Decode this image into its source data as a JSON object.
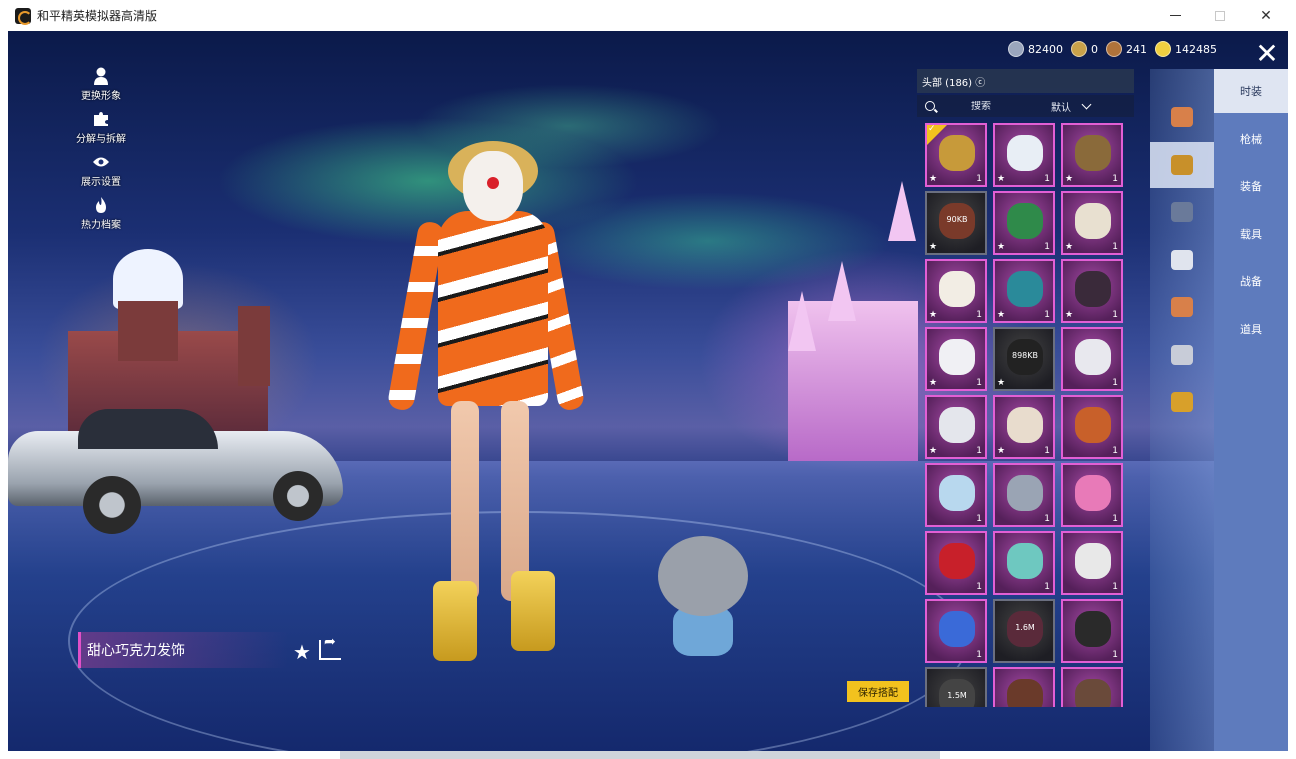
{
  "window": {
    "title": "和平精英模拟器高清版"
  },
  "currencies": [
    {
      "icon": "coin-icon",
      "value": "82400",
      "color": "#9aa6bd"
    },
    {
      "icon": "token-icon",
      "value": "0",
      "color": "#c9a24a"
    },
    {
      "icon": "medal-icon",
      "value": "241",
      "color": "#b0733a"
    },
    {
      "icon": "gold-coin-icon",
      "value": "142485",
      "color": "#f0d040"
    }
  ],
  "left_menu": [
    {
      "icon": "person-icon",
      "label": "更换形象"
    },
    {
      "icon": "puzzle-icon",
      "label": "分解与拆解"
    },
    {
      "icon": "eye-icon",
      "label": "展示设置"
    },
    {
      "icon": "flame-icon",
      "label": "热力档案"
    }
  ],
  "selected_item": {
    "name": "甜心巧克力发饰"
  },
  "save_button": "保存搭配",
  "panel": {
    "header": "头部 (186) ⓒ",
    "search_placeholder": "搜索",
    "sort_value": "默认"
  },
  "grid_items": [
    {
      "rarity": "purple",
      "art": "#c79a3a",
      "star": true,
      "qty": "1",
      "equipped": true
    },
    {
      "rarity": "purple",
      "art": "#e8eef5",
      "star": true,
      "qty": "1"
    },
    {
      "rarity": "purple",
      "art": "#8a6a3a",
      "star": true,
      "qty": "1"
    },
    {
      "rarity": "dark",
      "art": "#7a3a2a",
      "star": true,
      "qty": "",
      "download": "90KB"
    },
    {
      "rarity": "purple",
      "art": "#2f8a4a",
      "star": true,
      "qty": "1"
    },
    {
      "rarity": "purple",
      "art": "#e8e0d0",
      "star": true,
      "qty": "1"
    },
    {
      "rarity": "purple",
      "art": "#f2ede4",
      "star": true,
      "qty": "1"
    },
    {
      "rarity": "purple",
      "art": "#2a8a9a",
      "star": true,
      "qty": "1"
    },
    {
      "rarity": "purple",
      "art": "#3a2a3a",
      "star": true,
      "qty": "1"
    },
    {
      "rarity": "purple",
      "art": "#f0f0f4",
      "star": true,
      "qty": "1"
    },
    {
      "rarity": "dark",
      "art": "#222222",
      "star": true,
      "qty": "",
      "download": "898KB"
    },
    {
      "rarity": "purple",
      "art": "#e8e8ee",
      "star": false,
      "qty": "1"
    },
    {
      "rarity": "purple",
      "art": "#e4e6ec",
      "star": true,
      "qty": "1"
    },
    {
      "rarity": "purple",
      "art": "#e8dccd",
      "star": true,
      "qty": "1"
    },
    {
      "rarity": "purple",
      "art": "#c8602a",
      "star": false,
      "qty": "1"
    },
    {
      "rarity": "purple",
      "art": "#b8d8ee",
      "star": false,
      "qty": "1"
    },
    {
      "rarity": "purple",
      "art": "#9aa4b4",
      "star": false,
      "qty": "1"
    },
    {
      "rarity": "purple",
      "art": "#e87ab8",
      "star": false,
      "qty": "1"
    },
    {
      "rarity": "purple",
      "art": "#c8202a",
      "star": false,
      "qty": "1"
    },
    {
      "rarity": "purple",
      "art": "#6ec8c0",
      "star": false,
      "qty": "1"
    },
    {
      "rarity": "purple",
      "art": "#e8e8e8",
      "star": false,
      "qty": "1"
    },
    {
      "rarity": "purple",
      "art": "#3a6ad8",
      "star": false,
      "qty": "1"
    },
    {
      "rarity": "dark",
      "art": "#5a2a3a",
      "star": false,
      "qty": "",
      "download": "1.6M"
    },
    {
      "rarity": "purple",
      "art": "#2a2a2a",
      "star": false,
      "qty": "1"
    },
    {
      "rarity": "dark",
      "art": "#444444",
      "star": false,
      "qty": "",
      "download": "1.5M"
    },
    {
      "rarity": "purple",
      "art": "#6a3a2a",
      "star": false,
      "qty": ""
    },
    {
      "rarity": "purple",
      "art": "#6a4a3a",
      "star": false,
      "qty": ""
    }
  ],
  "sub_categories": [
    {
      "icon": "hair-icon",
      "color": "#d8804a"
    },
    {
      "icon": "hat-icon",
      "color": "#c8902a",
      "active": true
    },
    {
      "icon": "glasses-icon",
      "color": "#6a7a9a"
    },
    {
      "icon": "mask-icon",
      "color": "#e0e4ee"
    },
    {
      "icon": "face-icon",
      "color": "#d8804a"
    },
    {
      "icon": "chest-icon",
      "color": "#c8ccd8"
    },
    {
      "icon": "accessory-icon",
      "color": "#d8a02a"
    }
  ],
  "tabs": [
    {
      "label": "时装",
      "active": true
    },
    {
      "label": "枪械"
    },
    {
      "label": "装备"
    },
    {
      "label": "载具"
    },
    {
      "label": "战备"
    },
    {
      "label": "道具"
    }
  ]
}
